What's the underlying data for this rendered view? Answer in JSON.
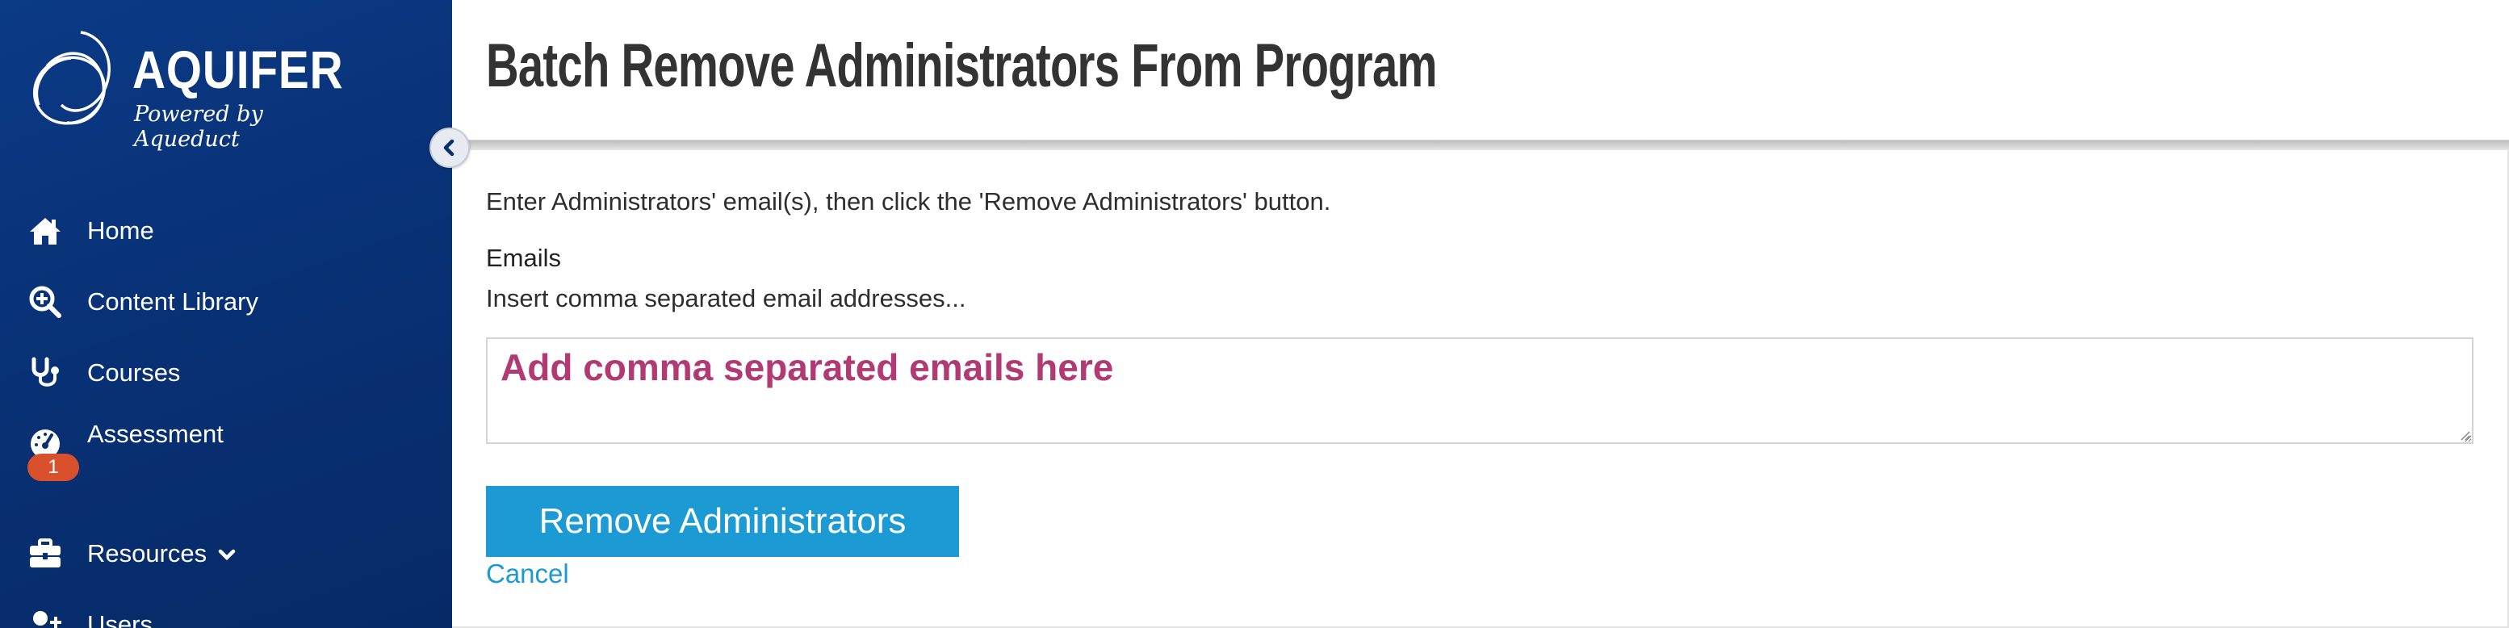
{
  "brand": {
    "name": "AQUIFER",
    "tagline": "Powered by Aqueduct"
  },
  "sidebar": {
    "items": [
      {
        "label": "Home",
        "icon": "home-icon"
      },
      {
        "label": "Content Library",
        "icon": "search-zoom-icon"
      },
      {
        "label": "Courses",
        "icon": "stethoscope-icon"
      },
      {
        "label": "Assessment",
        "icon": "gauge-icon",
        "badge": "1"
      },
      {
        "label": "Resources",
        "icon": "briefcase-icon",
        "has_dropdown": true
      },
      {
        "label": "Users",
        "icon": "add-user-icon"
      }
    ],
    "collapse_icon": "chevron-left-icon"
  },
  "page": {
    "title": "Batch Remove Administrators From Program",
    "intro": "Enter Administrators' email(s), then click the 'Remove Administrators' button.",
    "emails_label": "Emails",
    "emails_help": "Insert comma separated email addresses...",
    "emails_placeholder": "Add comma separated emails here",
    "emails_value": "",
    "remove_button": "Remove Administrators",
    "cancel_link": "Cancel"
  },
  "colors": {
    "sidebar": "#083073",
    "accent": "#1b9ad3",
    "badge": "#d9512c",
    "placeholder": "#b23a74"
  }
}
